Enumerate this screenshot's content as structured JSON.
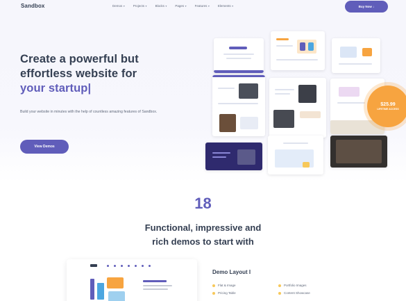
{
  "brand": {
    "logo": "Sandbox"
  },
  "nav": {
    "items": [
      {
        "label": "Demos"
      },
      {
        "label": "Projects"
      },
      {
        "label": "Blocks"
      },
      {
        "label": "Pages"
      },
      {
        "label": "Features"
      },
      {
        "label": "Elements"
      }
    ],
    "buy_label": "Buy Now ↓"
  },
  "hero": {
    "title_line1": "Create a powerful but",
    "title_line2": "effortless website for",
    "title_accent": "your startup|",
    "subtitle": "Build your website in minutes with the help of countless amazing features of Sandbox.",
    "cta_label": "View Demos"
  },
  "badge": {
    "line1": "$25.99",
    "line2": "LIFETIME ACCESS"
  },
  "section": {
    "count": "18",
    "title_line1": "Functional, impressive and",
    "title_line2": "rich demos to start with"
  },
  "demo": {
    "heading": "Demo Layout I",
    "features": [
      "Flat & Image",
      "Portfolio Images",
      "Pricing Table",
      "Content Showcase"
    ]
  },
  "colors": {
    "primary": "#605dba",
    "accent": "#f7a440",
    "text": "#343f52",
    "muted": "#60697b",
    "background": "#f6f6fc"
  }
}
